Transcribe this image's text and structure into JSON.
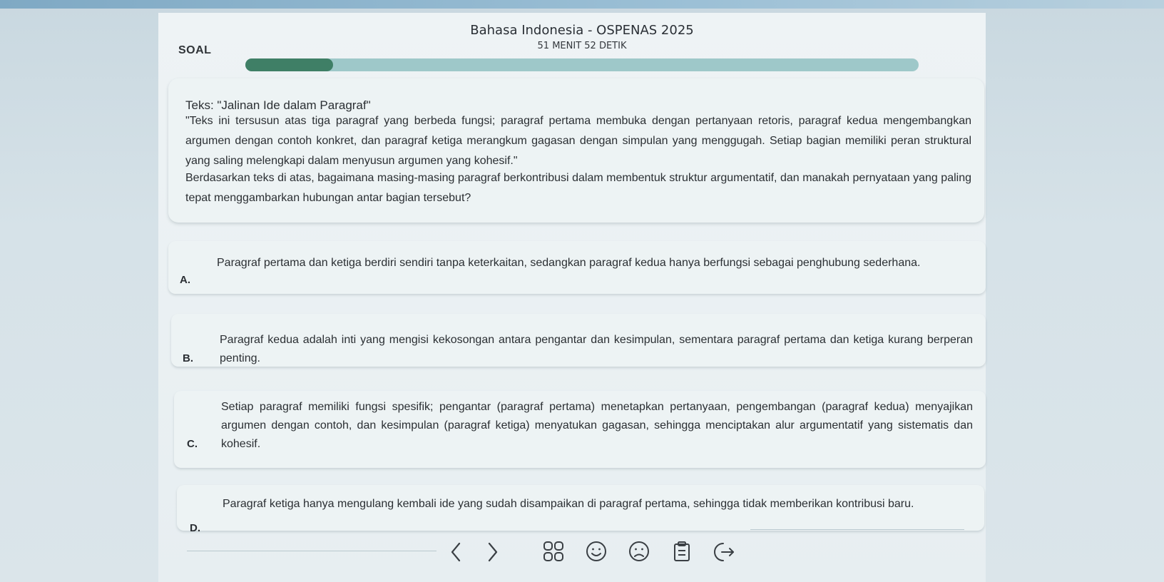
{
  "header": {
    "title": "Bahasa Indonesia - OSPENAS 2025",
    "soal_label": "SOAL",
    "timer": "51 MENIT 52 DETIK",
    "progress_fraction": 0.13
  },
  "question": {
    "title": "Teks: \"Jalinan Ide dalam Paragraf\"",
    "quote": "\"Teks ini tersusun atas tiga paragraf yang berbeda fungsi; paragraf pertama membuka dengan pertanyaan retoris, paragraf kedua mengembangkan argumen dengan contoh konkret, dan paragraf ketiga merangkum gagasan dengan simpulan yang menggugah. Setiap bagian memiliki peran struktural yang saling melengkapi dalam menyusun argumen yang kohesif.\"",
    "prompt": "Berdasarkan teks di atas, bagaimana masing-masing paragraf berkontribusi dalam membentuk struktur argumentatif, dan manakah pernyataan yang paling tepat menggambarkan hubungan antar bagian tersebut?"
  },
  "options": [
    {
      "letter": "A.",
      "text": "Paragraf pertama dan ketiga berdiri sendiri tanpa keterkaitan, sedangkan paragraf kedua hanya berfungsi sebagai penghubung sederhana."
    },
    {
      "letter": "B.",
      "text": "Paragraf kedua adalah inti yang mengisi kekosongan antara pengantar dan kesimpulan, sementara paragraf pertama dan ketiga kurang berperan penting."
    },
    {
      "letter": "C.",
      "text": "Setiap paragraf memiliki fungsi spesifik; pengantar (paragraf pertama) menetapkan pertanyaan, pengembangan (paragraf kedua) menyajikan argumen dengan contoh, dan kesimpulan (paragraf ketiga) menyatukan gagasan, sehingga menciptakan alur argumentatif yang sistematis dan kohesif."
    },
    {
      "letter": "D.",
      "text": "Paragraf ketiga hanya mengulang kembali ide yang sudah disampaikan di paragraf pertama, sehingga tidak memberikan kontribusi baru."
    }
  ],
  "nav": {
    "icons": [
      "chevron-left-icon",
      "chevron-right-icon",
      "grid-icon",
      "smile-icon",
      "sad-icon",
      "clipboard-icon",
      "exit-icon"
    ]
  },
  "colors": {
    "progress_fill": "#3f7f66",
    "progress_track": "#9ec8c9",
    "card": "#edf3f4",
    "background": "#d6e2e8"
  }
}
